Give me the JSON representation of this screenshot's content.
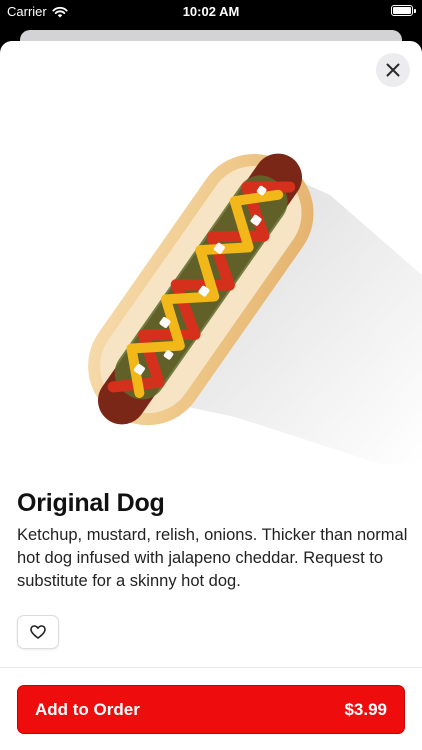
{
  "status_bar": {
    "carrier": "Carrier",
    "time": "10:02 AM"
  },
  "product": {
    "name": "Original Dog",
    "description": "Ketchup, mustard, relish, onions. Thicker than normal hot dog infused with jalapeno cheddar. Request to substitute for a skinny hot dog."
  },
  "actions": {
    "add_label": "Add to Order",
    "price": "$3.99"
  },
  "colors": {
    "accent": "#ee0c0c",
    "status_bar_bg": "#000000",
    "sheet_bg": "#ffffff"
  },
  "icons": {
    "wifi": "wifi-icon",
    "battery": "battery-icon",
    "close": "close-icon",
    "favorite": "heart-outline-icon"
  }
}
